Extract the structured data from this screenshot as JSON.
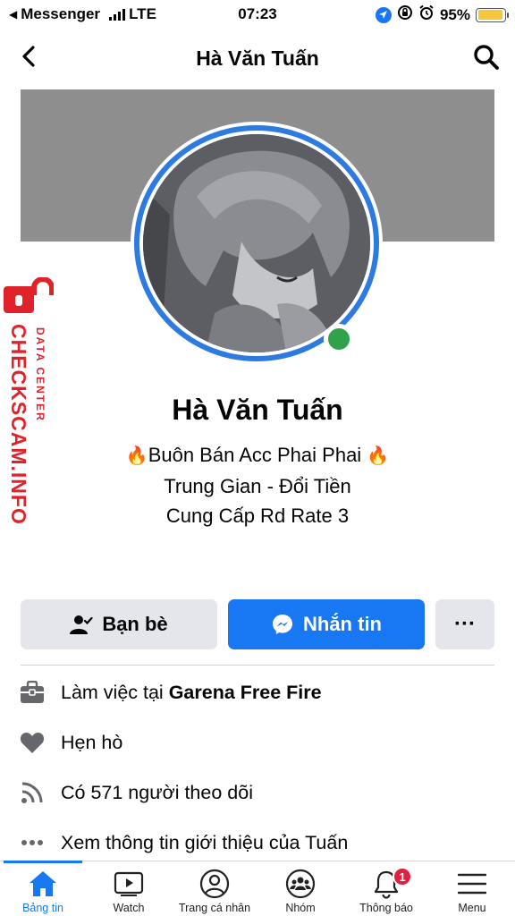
{
  "status_bar": {
    "carrier_app": "Messenger",
    "network": "LTE",
    "time": "07:23",
    "battery": "95%",
    "battery_level": 0.95
  },
  "header": {
    "title": "Hà Văn Tuấn"
  },
  "watermark": {
    "main_text": "CHECKSCAM.INFO",
    "sub_text": "DATA CENTER"
  },
  "profile": {
    "name": "Hà Văn Tuấn",
    "bio_lines": [
      "Buôn Bán Acc Phai Phai",
      "Trung Gian - Đổi Tiền",
      "Cung Cấp Rd Rate 3"
    ],
    "online": true
  },
  "actions": {
    "friends_label": "Bạn bè",
    "message_label": "Nhắn tin",
    "more_label": "···"
  },
  "info": {
    "work_prefix": "Làm việc tại ",
    "work_place": "Garena Free Fire",
    "dating": "Hẹn hò",
    "followers": "Có 571 người theo dõi",
    "about": "Xem thông tin giới thiệu của Tuấn"
  },
  "tabs": [
    {
      "label": "Bảng tin",
      "icon": "home-icon",
      "active": true
    },
    {
      "label": "Watch",
      "icon": "watch-icon",
      "active": false
    },
    {
      "label": "Trang cá nhân",
      "icon": "profile-icon",
      "active": false
    },
    {
      "label": "Nhóm",
      "icon": "groups-icon",
      "active": false
    },
    {
      "label": "Thông báo",
      "icon": "bell-icon",
      "active": false,
      "badge": "1"
    },
    {
      "label": "Menu",
      "icon": "menu-icon",
      "active": false
    }
  ],
  "colors": {
    "accent": "#1877f2",
    "online": "#31a24c",
    "watermark": "#e0232a",
    "badge": "#e41e3f"
  }
}
